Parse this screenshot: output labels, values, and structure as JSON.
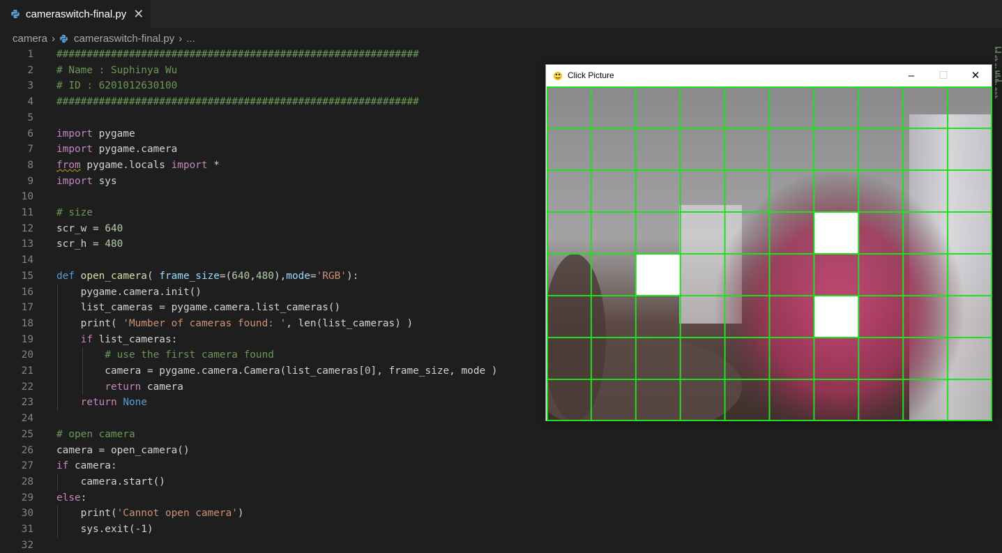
{
  "tab": {
    "title": "cameraswitch-final.py",
    "close": "✕"
  },
  "breadcrumb": {
    "folder": "camera",
    "file": "cameraswitch-final.py",
    "more": "..."
  },
  "editor": {
    "lines": [
      {
        "n": "1",
        "t": [
          [
            "c",
            "############################################################"
          ]
        ]
      },
      {
        "n": "2",
        "t": [
          [
            "c",
            "# Name : Suphinya Wu"
          ]
        ]
      },
      {
        "n": "3",
        "t": [
          [
            "c",
            "# ID : 6201012630100"
          ]
        ]
      },
      {
        "n": "4",
        "t": [
          [
            "c",
            "############################################################"
          ]
        ]
      },
      {
        "n": "5",
        "t": []
      },
      {
        "n": "6",
        "t": [
          [
            "k",
            "import"
          ],
          [
            "p",
            " pygame"
          ]
        ]
      },
      {
        "n": "7",
        "t": [
          [
            "k",
            "import"
          ],
          [
            "p",
            " pygame.camera"
          ]
        ]
      },
      {
        "n": "8",
        "t": [
          [
            "ks",
            "from"
          ],
          [
            "p",
            " pygame.locals "
          ],
          [
            "k",
            "import"
          ],
          [
            "p",
            " *"
          ]
        ]
      },
      {
        "n": "9",
        "t": [
          [
            "k",
            "import"
          ],
          [
            "p",
            " sys"
          ]
        ]
      },
      {
        "n": "10",
        "t": []
      },
      {
        "n": "11",
        "t": [
          [
            "c",
            "# size"
          ]
        ]
      },
      {
        "n": "12",
        "t": [
          [
            "p",
            "scr_w = "
          ],
          [
            "n",
            "640"
          ]
        ]
      },
      {
        "n": "13",
        "t": [
          [
            "p",
            "scr_h = "
          ],
          [
            "n",
            "480"
          ]
        ]
      },
      {
        "n": "14",
        "t": []
      },
      {
        "n": "15",
        "t": [
          [
            "d",
            "def"
          ],
          [
            "p",
            " "
          ],
          [
            "f",
            "open_camera"
          ],
          [
            "p",
            "( "
          ],
          [
            "a",
            "frame_size"
          ],
          [
            "p",
            "=("
          ],
          [
            "n",
            "640"
          ],
          [
            "p",
            ","
          ],
          [
            "n",
            "480"
          ],
          [
            "p",
            "),"
          ],
          [
            "a",
            "mode"
          ],
          [
            "p",
            "="
          ],
          [
            "s",
            "'RGB'"
          ],
          [
            "p",
            "):"
          ]
        ]
      },
      {
        "n": "16",
        "t": [
          [
            "p",
            "    pygame.camera.init()"
          ]
        ]
      },
      {
        "n": "17",
        "t": [
          [
            "p",
            "    list_cameras = pygame.camera.list_cameras()"
          ]
        ]
      },
      {
        "n": "18",
        "t": [
          [
            "p",
            "    print( "
          ],
          [
            "s",
            "'Mumber of cameras found: '"
          ],
          [
            "p",
            ", len(list_cameras) )"
          ]
        ]
      },
      {
        "n": "19",
        "t": [
          [
            "p",
            "    "
          ],
          [
            "k",
            "if"
          ],
          [
            "p",
            " list_cameras:"
          ]
        ]
      },
      {
        "n": "20",
        "t": [
          [
            "p",
            "        "
          ],
          [
            "c",
            "# use the first camera found"
          ]
        ]
      },
      {
        "n": "21",
        "t": [
          [
            "p",
            "        camera = pygame.camera.Camera(list_cameras["
          ],
          [
            "n",
            "0"
          ],
          [
            "p",
            "], frame_size, mode )"
          ]
        ]
      },
      {
        "n": "22",
        "t": [
          [
            "p",
            "        "
          ],
          [
            "k",
            "return"
          ],
          [
            "p",
            " camera"
          ]
        ]
      },
      {
        "n": "23",
        "t": [
          [
            "p",
            "    "
          ],
          [
            "k",
            "return"
          ],
          [
            "p",
            " "
          ],
          [
            "d",
            "None"
          ]
        ]
      },
      {
        "n": "24",
        "t": []
      },
      {
        "n": "25",
        "t": [
          [
            "c",
            "# open camera"
          ]
        ]
      },
      {
        "n": "26",
        "t": [
          [
            "p",
            "camera = open_camera()"
          ]
        ]
      },
      {
        "n": "27",
        "t": [
          [
            "k",
            "if"
          ],
          [
            "p",
            " camera:"
          ]
        ]
      },
      {
        "n": "28",
        "t": [
          [
            "p",
            "    camera.start()"
          ]
        ]
      },
      {
        "n": "29",
        "t": [
          [
            "k",
            "else"
          ],
          [
            "p",
            ":"
          ]
        ]
      },
      {
        "n": "30",
        "t": [
          [
            "p",
            "    print("
          ],
          [
            "s",
            "'Cannot open camera'"
          ],
          [
            "p",
            ")"
          ]
        ]
      },
      {
        "n": "31",
        "t": [
          [
            "p",
            "    sys.exit(-1)"
          ]
        ]
      },
      {
        "n": "32",
        "t": []
      }
    ]
  },
  "pygame_window": {
    "title": "Click Picture",
    "minimize": "–",
    "maximize": "☐",
    "close": "✕",
    "grid": {
      "columns": 10,
      "rows": 8,
      "line_color": "#1fe01f",
      "white_cells": [
        [
          2,
          4
        ],
        [
          6,
          3
        ],
        [
          6,
          5
        ]
      ]
    }
  },
  "colors": {
    "editor_bg": "#1e1e1e",
    "tab_bg": "#252526",
    "grid_line": "#1fe01f"
  }
}
